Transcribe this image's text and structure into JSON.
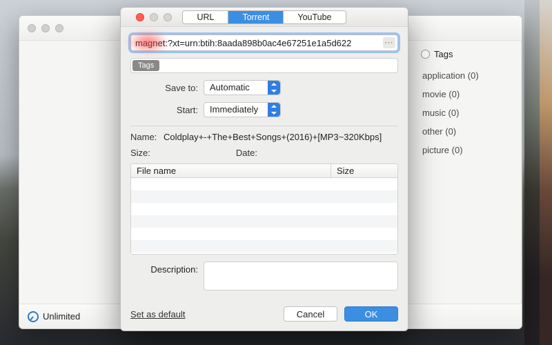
{
  "colors": {
    "accent": "#3b8fe3",
    "highlight_red": "rgba(255,70,70,.7)"
  },
  "back_window": {
    "sidebar": {
      "heading_label": "Tags",
      "tags": [
        {
          "label": "application (0)"
        },
        {
          "label": "movie (0)"
        },
        {
          "label": "music (0)"
        },
        {
          "label": "other (0)"
        },
        {
          "label": "picture (0)"
        }
      ]
    },
    "footer": {
      "speed_label": "Unlimited"
    }
  },
  "modal": {
    "tabs": [
      {
        "label": "URL",
        "active": false
      },
      {
        "label": "Torrent",
        "active": true
      },
      {
        "label": "YouTube",
        "active": false
      }
    ],
    "url_value": "magnet:?xt=urn:btih:8aada898b0ac4e67251e1a5d622",
    "url_more_glyph": "···",
    "tags_badge": "Tags",
    "save_to": {
      "label": "Save to:",
      "value": "Automatic"
    },
    "start": {
      "label": "Start:",
      "value": "Immediately"
    },
    "info": {
      "name_label": "Name:",
      "name_value": "Coldplay+-+The+Best+Songs+(2016)+[MP3~320Kbps]",
      "size_label": "Size:",
      "size_value": "",
      "date_label": "Date:",
      "date_value": ""
    },
    "table": {
      "col_filename": "File name",
      "col_size": "Size"
    },
    "description_label": "Description:",
    "description_value": "",
    "set_default_label": "Set as default",
    "cancel_label": "Cancel",
    "ok_label": "OK"
  }
}
